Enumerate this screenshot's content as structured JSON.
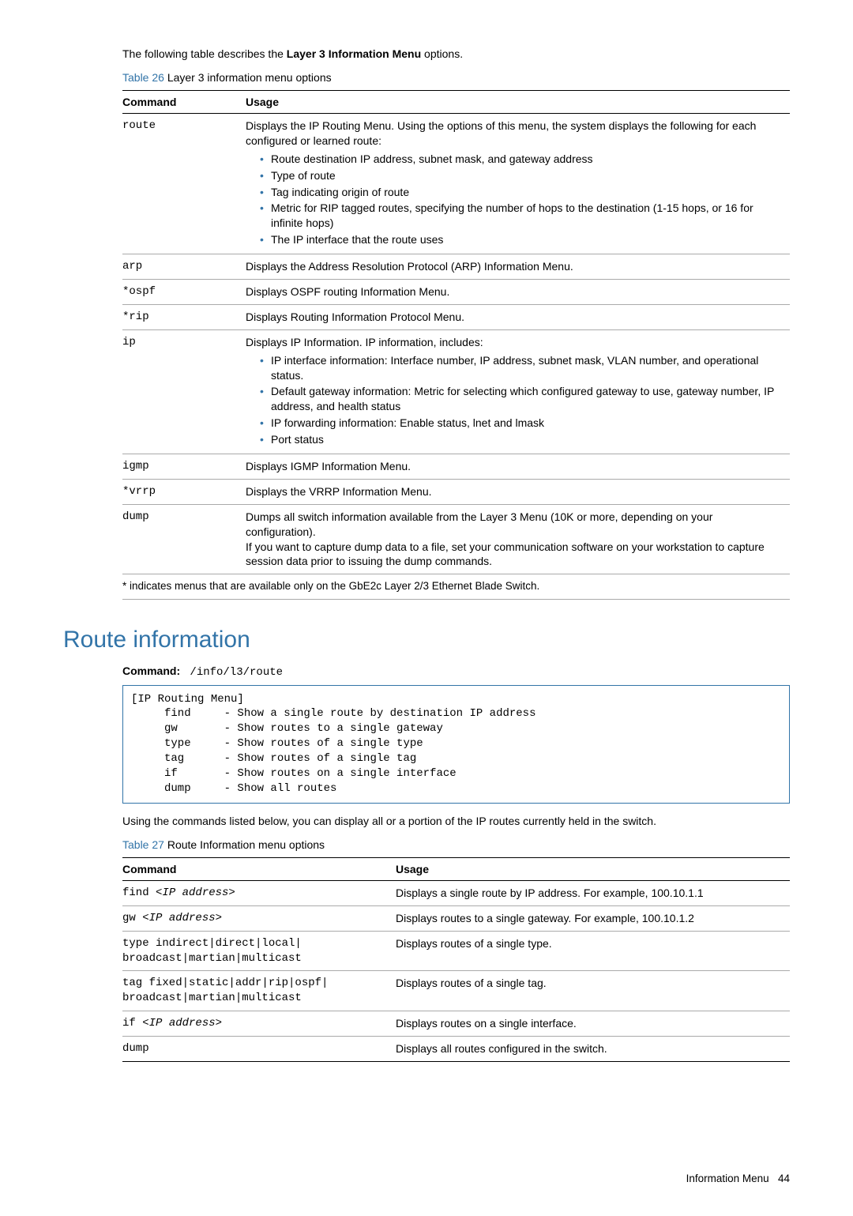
{
  "intro_before": "The following table describes the ",
  "intro_bold": "Layer 3 Information Menu",
  "intro_after": " options.",
  "table26": {
    "label": "Table 26",
    "caption": "  Layer 3 information menu options",
    "head_cmd": "Command",
    "head_usage": "Usage",
    "rows": [
      {
        "cmd": "route",
        "usage_pre": "Displays the IP Routing Menu. Using the options of this menu, the system displays the following for each configured or learned route:",
        "bullets": [
          "Route destination IP address, subnet mask, and gateway address",
          "Type of route",
          "Tag indicating origin of route",
          "Metric for RIP tagged routes, specifying the number of hops to the destination (1-15 hops, or 16 for infinite hops)",
          "The IP interface that the route uses"
        ]
      },
      {
        "cmd": "arp",
        "usage": "Displays the Address Resolution Protocol (ARP) Information Menu."
      },
      {
        "cmd": "*ospf",
        "usage": "Displays OSPF routing Information Menu."
      },
      {
        "cmd": "*rip",
        "usage": "Displays Routing Information Protocol Menu."
      },
      {
        "cmd": "ip",
        "usage_pre": "Displays IP Information. IP information, includes:",
        "bullets": [
          "IP interface information: Interface number, IP address, subnet mask, VLAN number, and operational status.",
          "Default gateway information: Metric for selecting which configured gateway to use, gateway number, IP address, and health status",
          "IP forwarding information: Enable status, lnet and lmask",
          "Port status"
        ]
      },
      {
        "cmd": "igmp",
        "usage": "Displays IGMP Information Menu."
      },
      {
        "cmd": "*vrrp",
        "usage": "Displays the VRRP Information Menu."
      },
      {
        "cmd": "dump",
        "usage": "Dumps all switch information available from the Layer 3 Menu (10K or more, depending on your configuration).\nIf you want to capture dump data to a file, set your communication software on your workstation to capture session data prior to issuing the dump commands."
      }
    ],
    "foot": "* indicates menus that are available only on the GbE2c Layer 2/3 Ethernet Blade Switch."
  },
  "section_title": "Route information",
  "cmdline_label": "Command:",
  "cmdline_value": "/info/l3/route",
  "codebox": "[IP Routing Menu]\n     find     - Show a single route by destination IP address\n     gw       - Show routes to a single gateway\n     type     - Show routes of a single type\n     tag      - Show routes of a single tag\n     if       - Show routes on a single interface\n     dump     - Show all routes",
  "para_after_code": "Using the commands listed below, you can display all or a portion of the IP routes currently held in the switch.",
  "table27": {
    "label": "Table 27",
    "caption": "  Route Information menu options",
    "head_cmd": "Command",
    "head_usage": "Usage",
    "rows": [
      {
        "cmd_roman": "find ",
        "cmd_ital": "<IP address>",
        "usage": "Displays a single route by IP address. For example, 100.10.1.1"
      },
      {
        "cmd_roman": "gw ",
        "cmd_ital": "<IP address>",
        "usage": "Displays routes to a single gateway. For example, 100.10.1.2"
      },
      {
        "cmd_roman": "type indirect|direct|local|\nbroadcast|martian|multicast",
        "cmd_ital": "",
        "usage": "Displays routes of a single type."
      },
      {
        "cmd_roman": "tag fixed|static|addr|rip|ospf|\nbroadcast|martian|multicast",
        "cmd_ital": "",
        "usage": "Displays routes of a single tag."
      },
      {
        "cmd_roman": "if ",
        "cmd_ital": "<IP address>",
        "usage": "Displays routes on a single interface."
      },
      {
        "cmd_roman": "dump",
        "cmd_ital": "",
        "usage": "Displays all routes configured in the switch."
      }
    ]
  },
  "footer_text": "Information Menu",
  "footer_page": "44"
}
